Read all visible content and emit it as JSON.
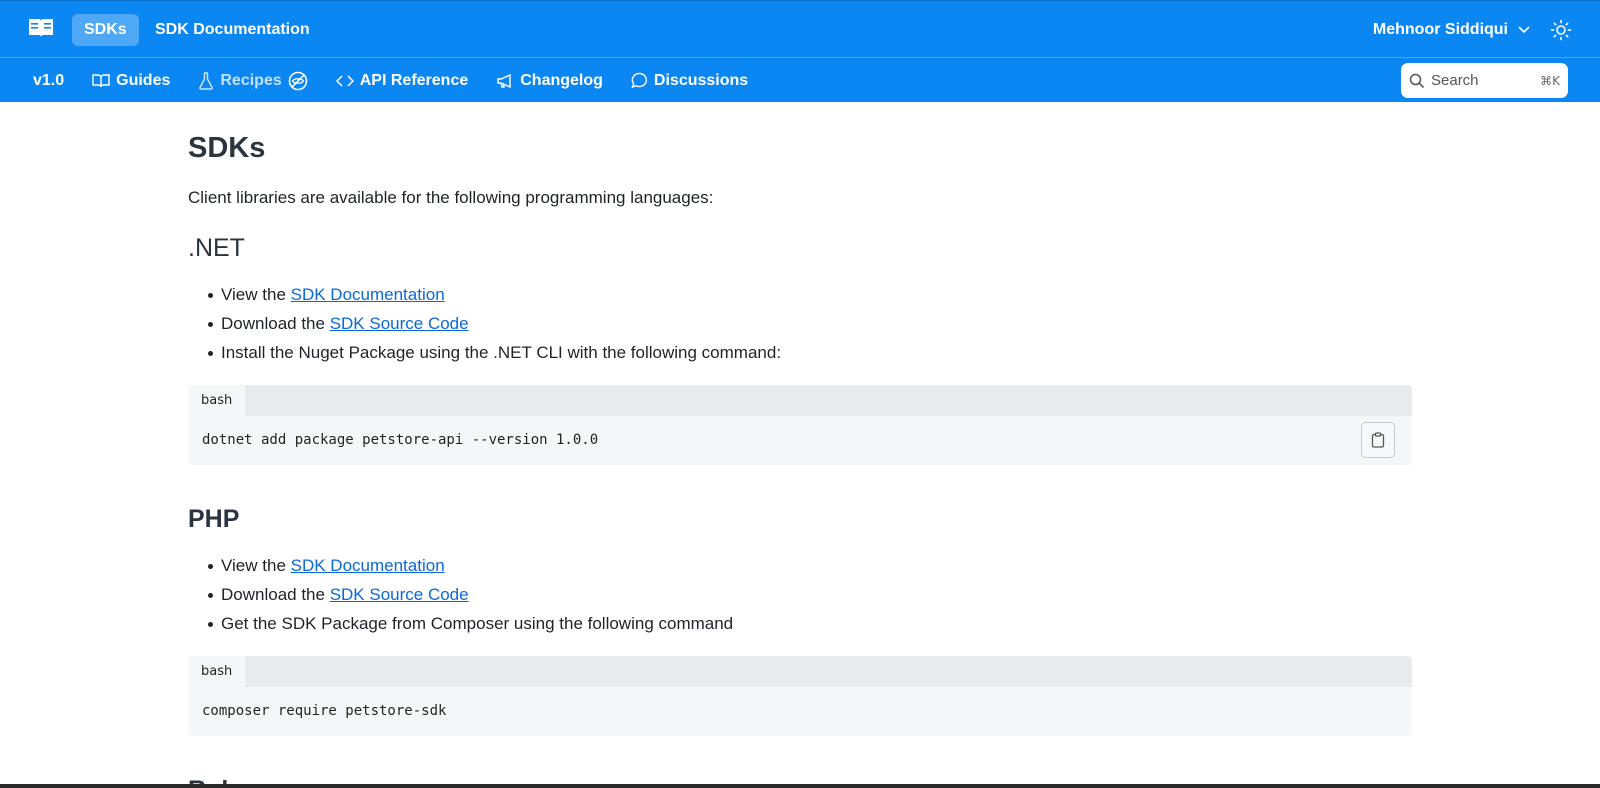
{
  "header": {
    "logo_icon": "book-icon",
    "active_pill": "SDKs",
    "project_title": "SDK Documentation",
    "user_name": "Mehnoor Siddiqui",
    "theme_icon": "sun-icon"
  },
  "nav": {
    "version": "v1.0",
    "items": [
      {
        "label": "Guides",
        "icon": "book-open-icon"
      },
      {
        "label": "Recipes",
        "icon": "flask-icon"
      },
      {
        "label": "API Reference",
        "icon": "code-brackets-icon"
      },
      {
        "label": "Changelog",
        "icon": "megaphone-icon"
      },
      {
        "label": "Discussions",
        "icon": "chat-bubble-icon"
      }
    ],
    "search_placeholder": "Search",
    "search_shortcut": "⌘K"
  },
  "page": {
    "title": "SDKs",
    "intro": "Client libraries are available for the following programming languages:",
    "sections": [
      {
        "heading": ".NET",
        "item1_prefix": "View the ",
        "item1_link": "SDK Documentation",
        "item2_prefix": "Download the ",
        "item2_link": "SDK Source Code",
        "item3": "Install the Nuget Package using the .NET CLI with the following command:",
        "code_lang": "bash",
        "code": "dotnet add package petstore-api --version 1.0.0"
      },
      {
        "heading": "PHP",
        "item1_prefix": "View the ",
        "item1_link": "SDK Documentation",
        "item2_prefix": "Download the ",
        "item2_link": "SDK Source Code",
        "item3": "Get the SDK Package from Composer using the following command",
        "code_lang": "bash",
        "code": "composer require petstore-sdk"
      }
    ],
    "next_heading_partial": "Ruby"
  }
}
